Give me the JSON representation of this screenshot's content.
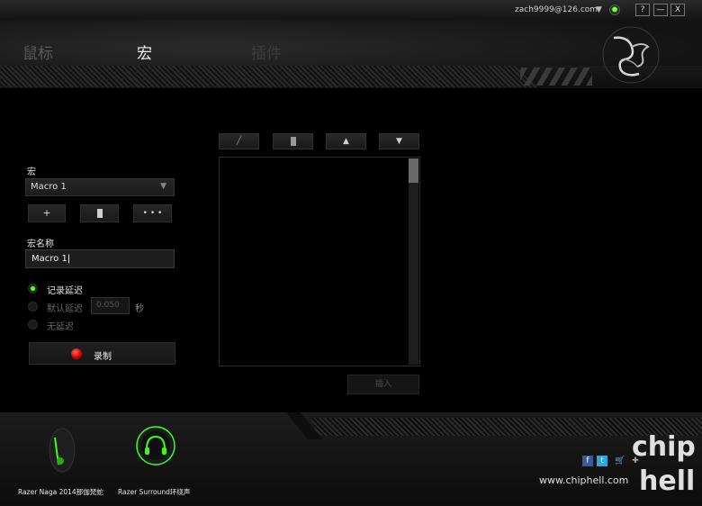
{
  "titlebar": {
    "email": "zach9999@126.com",
    "dropdown_icon": "triangle-down-icon",
    "status_color": "#7cff3a",
    "buttons": [
      "?",
      "—",
      "X"
    ]
  },
  "tabs": [
    {
      "label": "鼠标",
      "active": false
    },
    {
      "label": "宏",
      "active": true
    },
    {
      "label": "插件",
      "active": false
    }
  ],
  "macro": {
    "section_label": "宏",
    "selected": "Macro 1",
    "add_label": "+",
    "delete_icon": "trash-icon",
    "more_label": "• • •",
    "name_label": "宏名称",
    "name_value": "Macro 1"
  },
  "delay": {
    "options": [
      "记录延迟",
      "默认延迟",
      "无延迟"
    ],
    "selected_index": 0,
    "default_value": "0.050",
    "unit": "秒"
  },
  "record": {
    "label": "录制",
    "indicator_color": "#d40000"
  },
  "editor": {
    "tools": [
      "pencil-icon",
      "trash-icon",
      "arrow-up-icon",
      "arrow-down-icon"
    ],
    "insert_label": "插入"
  },
  "devices": [
    {
      "name": "Razer Naga 2014那伽梵蛇",
      "icon": "mouse-icon",
      "accent": "#39ff14"
    },
    {
      "name": "Razer Surround环绕声",
      "icon": "headphones-icon",
      "accent": "#39ff14"
    }
  ],
  "footer": {
    "social": [
      "facebook-icon",
      "twitter-icon",
      "cart-icon",
      "puzzle-icon"
    ],
    "site": "www.chiphell.com",
    "watermark": "chip hell"
  }
}
